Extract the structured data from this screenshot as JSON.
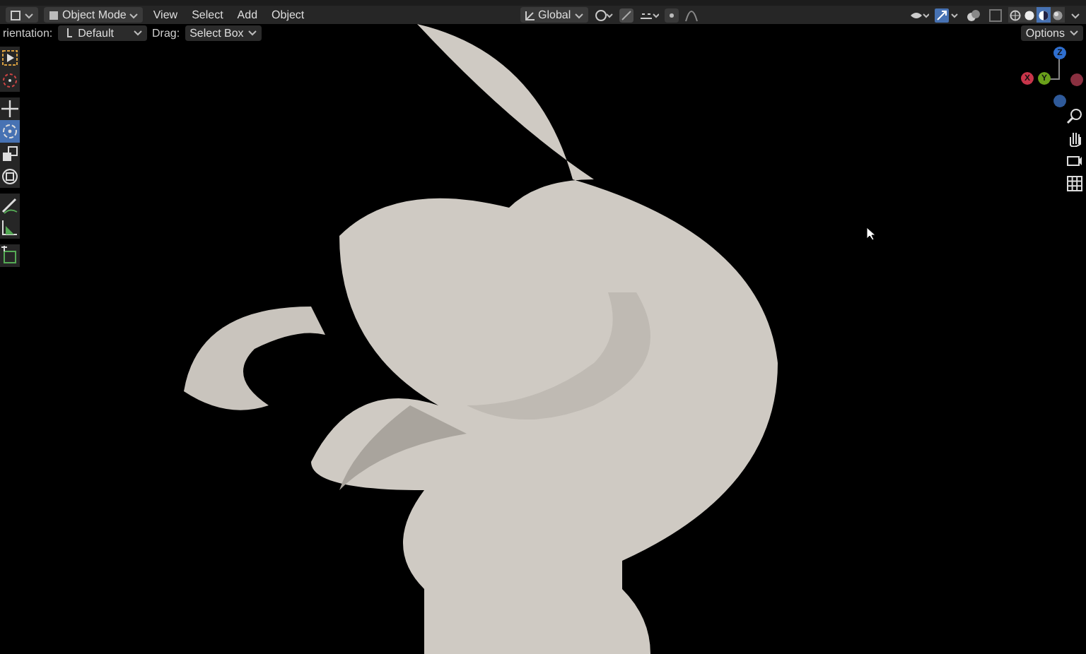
{
  "header": {
    "mode": "Object Mode",
    "menus": [
      "View",
      "Select",
      "Add",
      "Object"
    ],
    "orientation": "Global",
    "shading": [
      {
        "kind": "wire",
        "selected": false
      },
      {
        "kind": "solid",
        "selected": false
      },
      {
        "kind": "material",
        "selected": true
      },
      {
        "kind": "rendered",
        "selected": false
      }
    ]
  },
  "tool_settings": {
    "orientation_label": "rientation:",
    "orientation_value": "Default",
    "drag_label": "Drag:",
    "drag_value": "Select Box",
    "options": "Options"
  },
  "toolbar": [
    {
      "tools": [
        {
          "kind": "select",
          "selected": false
        },
        {
          "kind": "cursor",
          "selected": false
        }
      ]
    },
    {
      "tools": [
        {
          "kind": "move",
          "selected": false
        },
        {
          "kind": "rotate",
          "selected": true
        },
        {
          "kind": "scale",
          "selected": false
        },
        {
          "kind": "transform",
          "selected": false
        }
      ]
    },
    {
      "tools": [
        {
          "kind": "annotate",
          "selected": false
        },
        {
          "kind": "measure",
          "selected": false
        }
      ]
    },
    {
      "tools": [
        {
          "kind": "add",
          "selected": false
        }
      ]
    }
  ],
  "gizmo": {
    "axes": [
      {
        "label": "Z",
        "color": "#2f6fd0"
      },
      {
        "label": "Y",
        "color": "#6aa01a"
      },
      {
        "label": "X",
        "color": "#c8354a"
      }
    ]
  }
}
